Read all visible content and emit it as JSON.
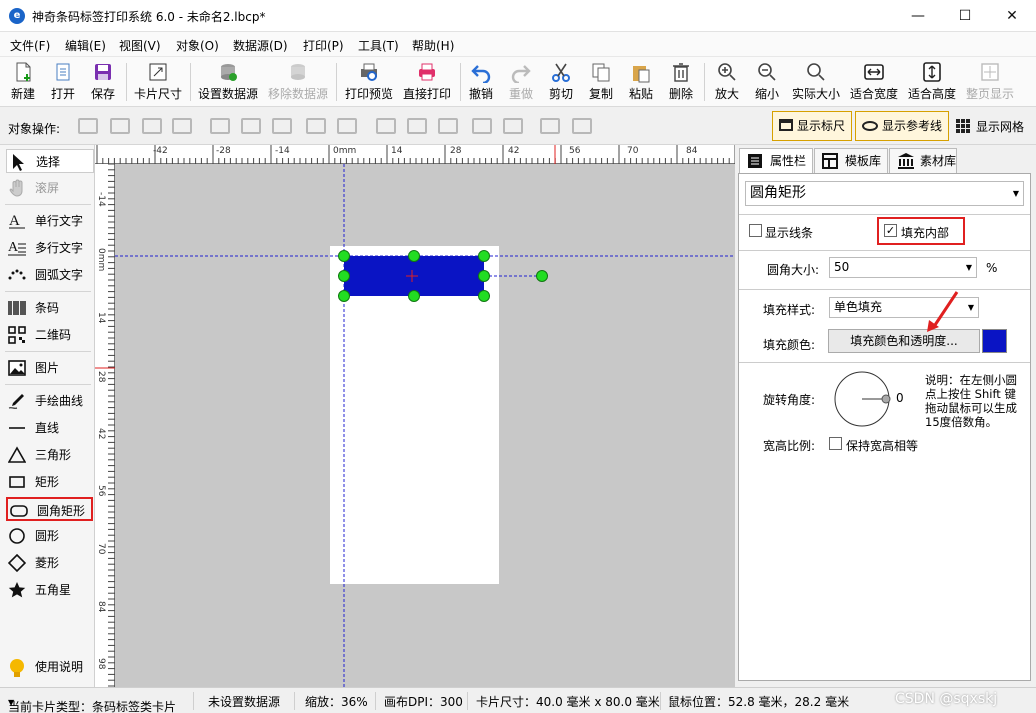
{
  "app": {
    "title": "神奇条码标签打印系统 6.0 - 未命名2.lbcp*",
    "icon_letter": "e"
  },
  "window_controls": {
    "minimize": "—",
    "maximize": "☐",
    "close": "✕"
  },
  "menu": [
    "文件(F)",
    "编辑(E)",
    "视图(V)",
    "对象(O)",
    "数据源(D)",
    "打印(P)",
    "工具(T)",
    "帮助(H)"
  ],
  "toolbar": {
    "new": "新建",
    "open": "打开",
    "save": "保存",
    "card_size": "卡片尺寸",
    "set_datasource": "设置数据源",
    "remove_datasource": "移除数据源",
    "print_preview": "打印预览",
    "direct_print": "直接打印",
    "undo": "撤销",
    "redo": "重做",
    "cut": "剪切",
    "copy": "复制",
    "paste": "粘贴",
    "delete": "删除",
    "zoom_in": "放大",
    "zoom_out": "缩小",
    "actual_size": "实际大小",
    "fit_width": "适合宽度",
    "fit_height": "适合高度",
    "full_page": "整页显示"
  },
  "objbar": {
    "label": "对象操作:",
    "show_ruler": "显示标尺",
    "show_guides": "显示参考线",
    "show_grid": "显示网格"
  },
  "tools": {
    "select": "选择",
    "scroll": "滚屏",
    "single_text": "单行文字",
    "multi_text": "多行文字",
    "arc_text": "圆弧文字",
    "barcode": "条码",
    "qrcode": "二维码",
    "image": "图片",
    "freehand": "手绘曲线",
    "line": "直线",
    "triangle": "三角形",
    "rect": "矩形",
    "round_rect": "圆角矩形",
    "ellipse": "圆形",
    "diamond": "菱形",
    "star": "五角星",
    "help": "使用说明"
  },
  "ruler": {
    "top": [
      "-42",
      "-28",
      "-14",
      "0mm",
      "14",
      "28",
      "42",
      "56",
      "70",
      "84"
    ],
    "left": [
      "-14",
      "0mm",
      "14",
      "28",
      "42",
      "56",
      "70",
      "84",
      "98"
    ]
  },
  "right_tabs": [
    "属性栏",
    "模板库",
    "素材库"
  ],
  "props": {
    "object_type": "圆角矩形",
    "show_border": "显示线条",
    "fill_inside": "填充内部",
    "show_border_checked": false,
    "fill_inside_checked": true,
    "corner_label": "圆角大小:",
    "corner_value": "50",
    "corner_unit": "%",
    "fill_style_label": "填充样式:",
    "fill_style_value": "单色填充",
    "fill_color_label": "填充颜色:",
    "fill_color_button": "填充颜色和透明度...",
    "fill_color": "#0a14c4",
    "rotation_label": "旋转角度:",
    "rotation_value": "0",
    "hint": [
      "说明：在左侧小圆",
      "点上按住 Shift 键",
      "拖动鼠标可以生成",
      "15度倍数角。"
    ],
    "aspect_label": "宽高比例:",
    "keep_aspect": "保持宽高相等"
  },
  "status": {
    "card_type": "当前卡片类型：条码标签类卡片",
    "datasource": "未设置数据源",
    "zoom": "缩放：36%",
    "dpi": "画布DPI：300",
    "card_size": "卡片尺寸：40.0 毫米 x 80.0 毫米",
    "mouse": "鼠标位置：52.8 毫米，28.2 毫米",
    "watermark": "CSDN @sqxskj"
  }
}
